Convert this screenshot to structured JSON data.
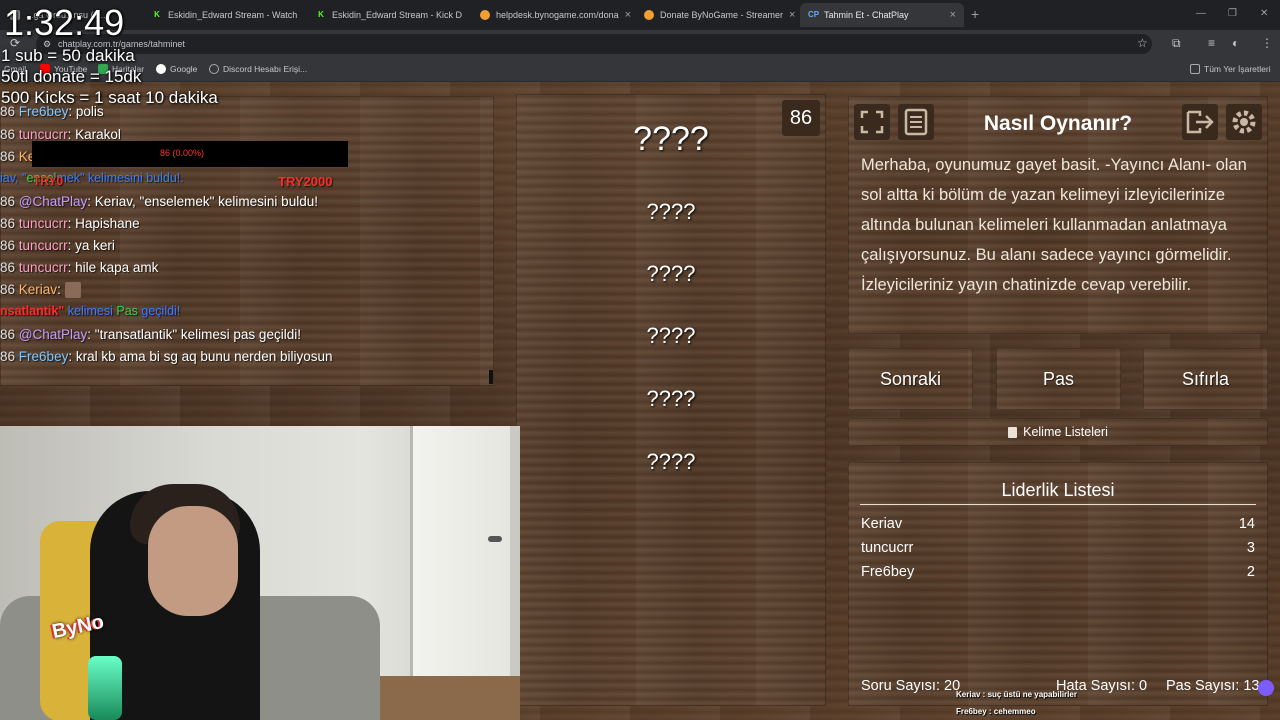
{
  "browser": {
    "tabs": [
      {
        "label": "...ga Ordu...nsu (O..."
      },
      {
        "label": "Eskidin_Edward Stream - Watch"
      },
      {
        "label": "Eskidin_Edward Stream - Kick D"
      },
      {
        "label": "helpdesk.bynogame.com/dona"
      },
      {
        "label": "Donate ByNoGame - Streamer"
      },
      {
        "label": "Tahmin Et - ChatPlay"
      }
    ],
    "new_tab": "+",
    "close": "×",
    "url": "chatplay.com.tr/games/tahminet",
    "bookmarks": [
      "Gmail",
      "YouTube",
      "Haritalar",
      "Google",
      "Discord Hesabı Erişi..."
    ],
    "all_bookmarks": "Tüm Yer İşaretleri",
    "window_controls": [
      "—",
      "❐",
      "✕"
    ]
  },
  "overlay": {
    "timer": "1:32:49",
    "lines": [
      "1 sub = 50 dakika",
      "50tl donate =  15dk",
      "500 Kicks  = 1 saat 10 dakika"
    ]
  },
  "chat": {
    "messages": [
      {
        "badge": "86",
        "user": "Fre6bey",
        "text": ": polis"
      },
      {
        "badge": "86",
        "user": "tuncucrr",
        "text": ": Karakol"
      },
      {
        "badge": "86",
        "user": "Ke",
        "text": ""
      },
      {
        "badge": "86",
        "user": "@ChatPlay",
        "text": ": Keriav, \"enselemek\" kelimesini buldu!"
      },
      {
        "badge": "86",
        "user": "tuncucrr",
        "text": ": Hapishane"
      },
      {
        "badge": "86",
        "user": "tuncucrr",
        "text": ": ya keri"
      },
      {
        "badge": "86",
        "user": "tuncucrr",
        "text": ": hile kapa amk"
      },
      {
        "badge": "86",
        "user": "Keriav",
        "text": ":"
      },
      {
        "badge": "86",
        "user": "@ChatPlay",
        "text": ": \"transatlantik\" kelimesi pas geçildi!"
      },
      {
        "badge": "86",
        "user": "Fre6bey",
        "text": ": kral kb ama bi sg aq bunu nerden biliyosun"
      }
    ],
    "alert1": {
      "pre": "iav, \"",
      "mid": "ensel",
      "post": "mek\" kelimesini buldu!.",
      "overlay": "TRY0",
      "amount": "TRY2000"
    },
    "alert2": {
      "word": "nsatlantik\"",
      "mid": " kelimesi ",
      "pas": "Pas",
      "post": " geçildi!"
    },
    "bar_text": "86 (0.00%)"
  },
  "words": {
    "count": "86",
    "items": [
      "????",
      "????",
      "????",
      "????",
      "????",
      "????"
    ]
  },
  "info": {
    "title": "Nasıl Oynanır?",
    "text": "Merhaba, oyunumuz gayet basit. -Yayıncı Alanı- olan sol altta ki bölüm de yazan kelimeyi izleyicilerinize altında bulunan kelimeleri kullanmadan anlatmaya çalışıyorsunuz. Bu alanı sadece yayıncı görmelidir. İzleyicileriniz yayın chatinizde cevap verebilir."
  },
  "buttons": {
    "next": "Sonraki",
    "pass": "Pas",
    "reset": "Sıfırla",
    "lists": "Kelime Listeleri"
  },
  "leaderboard": {
    "title": "Liderlik Listesi",
    "rows": [
      {
        "name": "Keriav",
        "score": "14"
      },
      {
        "name": "tuncucrr",
        "score": "3"
      },
      {
        "name": "Fre6bey",
        "score": "2"
      }
    ]
  },
  "stats": {
    "questions": "Soru Sayısı: 20",
    "errors": "Hata Sayısı: 0",
    "passes": "Pas Sayısı: 13"
  },
  "stream": {
    "logo": "ByNo",
    "tts1": "Keriav : suç üstü ne yapabilirler",
    "tts2": "Fre6bey : cehemmeo"
  },
  "colors": {
    "accent_red": "#ff2b2b",
    "accent_blue": "#3b7dff",
    "accent_green": "#3ccf4e"
  }
}
